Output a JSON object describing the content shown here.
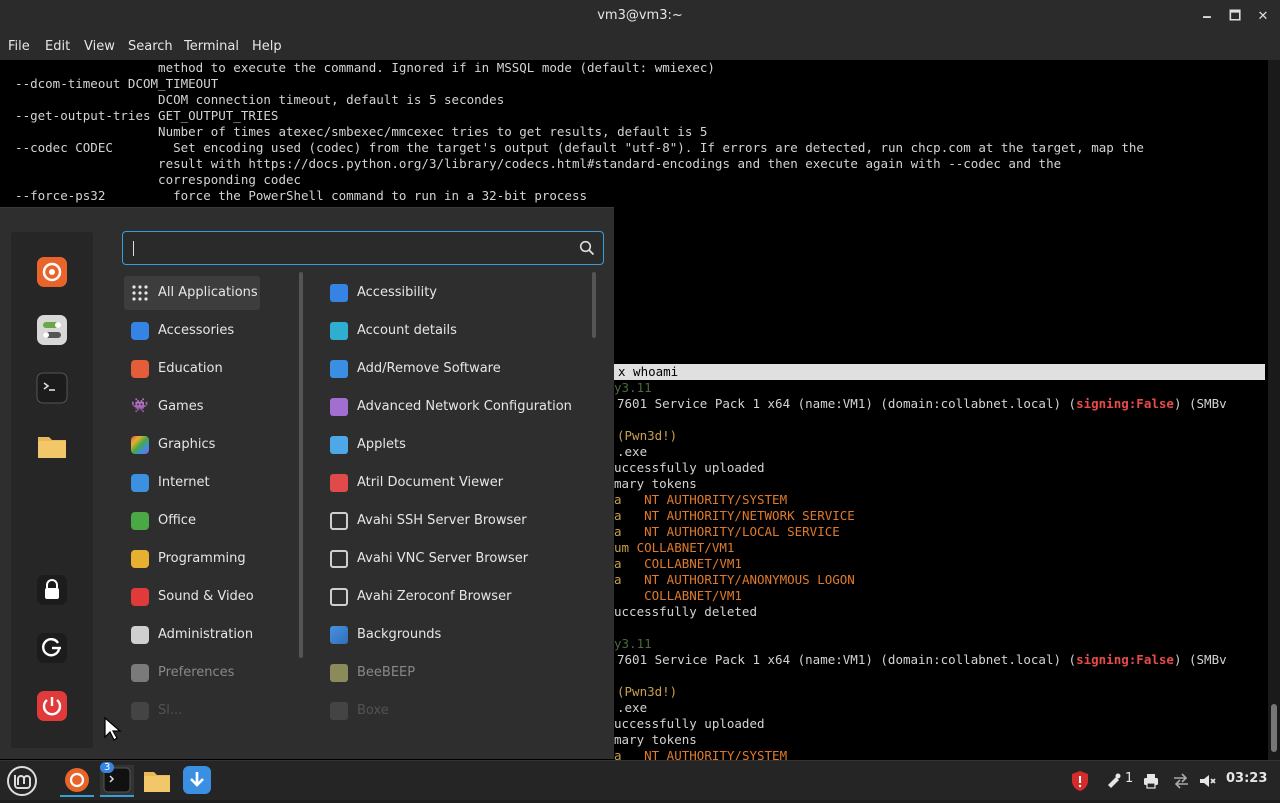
{
  "window": {
    "title": "vm3@vm3:~",
    "minimize": "🗕",
    "maximize": "🗖",
    "close": "✕"
  },
  "menubar": [
    "File",
    "Edit",
    "View",
    "Search",
    "Terminal",
    "Help"
  ],
  "terminal": {
    "top_lines": [
      "                     method to execute the command. Ignored if in MSSQL mode (default: wmiexec)",
      "  --dcom-timeout DCOM_TIMEOUT",
      "                     DCOM connection timeout, default is 5 secondes",
      "  --get-output-tries GET_OUTPUT_TRIES",
      "                     Number of times atexec/smbexec/mmcexec tries to get results, default is 5",
      "  --codec CODEC        Set encoding used (codec) from the target's output (default \"utf-8\"). If errors are detected, run chcp.com at the target, map the",
      "                     result with https://docs.python.org/3/library/codecs.html#standard-encodings and then execute again with --codec and the",
      "                     corresponding codec",
      "  --force-ps32         force the PowerShell command to run in a 32-bit process"
    ],
    "cmd_line": "x whoami",
    "ip1": "y3.11",
    "svc1_a": "7601 Service Pack 1 x64 (name:VM1) (domain:collabnet.local) (",
    "signing_label": "signing:",
    "signing_value": "False",
    "smb_tail": ") (SMBv",
    "pwn": "(Pwn3d!)",
    "exe": ".exe",
    "uploaded": "uccessfully uploaded",
    "tokens": "mary tokens",
    "tok_rows": [
      {
        "pre": "a   ",
        "val": "NT AUTHORITY/SYSTEM"
      },
      {
        "pre": "a   ",
        "val": "NT AUTHORITY/NETWORK SERVICE"
      },
      {
        "pre": "a   ",
        "val": "NT AUTHORITY/LOCAL SERVICE"
      },
      {
        "pre": "um ",
        "val": "COLLABNET/VM1"
      },
      {
        "pre": "a   ",
        "val": "COLLABNET/VM1"
      },
      {
        "pre": "a   ",
        "val": "NT AUTHORITY/ANONYMOUS LOGON"
      },
      {
        "pre": "    ",
        "val": "COLLABNET/VM1"
      }
    ],
    "deleted": "uccessfully deleted",
    "ip2": "y3.11",
    "pwn2": "(Pwn3d!)",
    "exe2": ".exe",
    "uploaded2": "uccessfully uploaded",
    "tokens2": "mary tokens",
    "last_pre": "a   ",
    "last_val": "NT AUTHORITY/SYSTEM"
  },
  "menu": {
    "search_placeholder": "",
    "categories": [
      {
        "label": "All Applications",
        "icon": "grid-icon",
        "color": "#e6e6e6",
        "selected": true
      },
      {
        "label": "Accessories",
        "icon": "scissors-icon",
        "color": "#3584e4"
      },
      {
        "label": "Education",
        "icon": "education-icon",
        "color": "#e35d3a"
      },
      {
        "label": "Games",
        "icon": "gamepad-icon",
        "color": "#e6e6e6"
      },
      {
        "label": "Graphics",
        "icon": "palette-icon",
        "color": "#9b59d0"
      },
      {
        "label": "Internet",
        "icon": "cloud-icon",
        "color": "#3d8fe0"
      },
      {
        "label": "Office",
        "icon": "office-icon",
        "color": "#4aa845"
      },
      {
        "label": "Programming",
        "icon": "code-icon",
        "color": "#e8b030"
      },
      {
        "label": "Sound & Video",
        "icon": "play-icon",
        "color": "#e03a3a"
      },
      {
        "label": "Administration",
        "icon": "admin-icon",
        "color": "#cfcfcf"
      },
      {
        "label": "Preferences",
        "icon": "toggle-icon",
        "color": "#9a9a9a",
        "dim": true
      },
      {
        "label": "Sl...",
        "icon": "places-icon",
        "color": "#888",
        "dim": true
      }
    ],
    "apps": [
      {
        "label": "Accessibility",
        "icon": "accessibility-icon",
        "color": "#3584e4"
      },
      {
        "label": "Account details",
        "icon": "account-icon",
        "color": "#2eaed0"
      },
      {
        "label": "Add/Remove Software",
        "icon": "download-icon",
        "color": "#3a8fe3"
      },
      {
        "label": "Advanced Network Configuration",
        "icon": "network-icon",
        "color": "#a26fd0"
      },
      {
        "label": "Applets",
        "icon": "applets-icon",
        "color": "#4ea8e8"
      },
      {
        "label": "Atril Document Viewer",
        "icon": "atril-icon",
        "color": "#e04a4a"
      },
      {
        "label": "Avahi SSH Server Browser",
        "icon": "monitor-icon",
        "color": "#cfcfcf"
      },
      {
        "label": "Avahi VNC Server Browser",
        "icon": "monitor-icon",
        "color": "#cfcfcf"
      },
      {
        "label": "Avahi Zeroconf Browser",
        "icon": "monitor-icon",
        "color": "#cfcfcf"
      },
      {
        "label": "Backgrounds",
        "icon": "backgrounds-icon",
        "color": "#4a90e2"
      },
      {
        "label": "BeeBEEP",
        "icon": "bee-icon",
        "color": "#9a9a6a",
        "dim": true
      },
      {
        "label": "Boxe",
        "icon": "boxes-icon",
        "color": "#888",
        "dim": true
      }
    ]
  },
  "taskbar": {
    "terminal_badge": "3",
    "notifications": "1",
    "time": "03:23"
  },
  "colors": {
    "accent": "#35a0d6",
    "firefox": "#e8642b",
    "mint": "#69a846"
  }
}
